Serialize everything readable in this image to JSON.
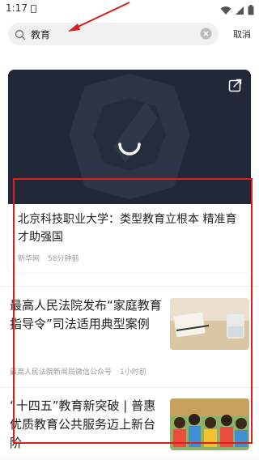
{
  "status_bar": {
    "time": "1:17"
  },
  "search": {
    "value": "教育",
    "cancel_label": "取消"
  },
  "featured": {
    "title": "北京科技职业大学：类型教育立根本 精准育才助强国",
    "source": "新华网",
    "time": "58分钟前"
  },
  "news": [
    {
      "title": "最高人民法院发布“家庭教育指导令”司法适用典型案例",
      "source": "最高人民法院新闻局微信公众号",
      "time": "1小时前"
    },
    {
      "title": "“十四五”教育新突破 | 普惠优质教育公共服务迈上新台阶"
    }
  ],
  "colors": {
    "annotation": "#d81e1e",
    "thumb_dark": "#242b3a",
    "search_bg": "#f1f1f1"
  },
  "icons": [
    "search-icon",
    "clear-icon",
    "share-icon",
    "loading-spinner",
    "wifi-icon",
    "signal-icon",
    "battery-icon"
  ]
}
